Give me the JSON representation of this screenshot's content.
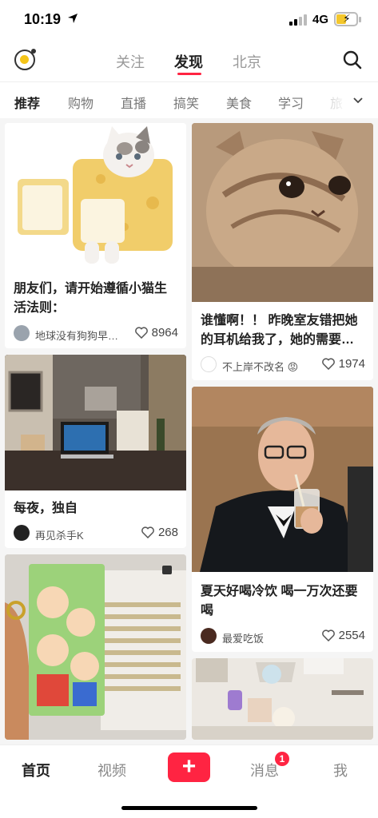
{
  "status_bar": {
    "time": "10:19",
    "network": "4G"
  },
  "top_nav": {
    "tabs": [
      {
        "label": "关注"
      },
      {
        "label": "发现"
      },
      {
        "label": "北京"
      }
    ],
    "active_tab": "发现"
  },
  "categories": [
    {
      "label": "推荐"
    },
    {
      "label": "购物"
    },
    {
      "label": "直播"
    },
    {
      "label": "搞笑"
    },
    {
      "label": "美食"
    },
    {
      "label": "学习"
    },
    {
      "label": "旅"
    }
  ],
  "feed": {
    "left": [
      {
        "title_line1": "朋友们，请开始遵循小猫生",
        "title_line2": "活法则：",
        "author": "地球没有狗狗早…",
        "likes": "8964"
      },
      {
        "title_line1": "每夜，独自",
        "author": "再见杀手K",
        "likes": "268"
      },
      {
        "title_line1": ""
      }
    ],
    "right": [
      {
        "title_line1": "谁懂啊！！ 昨晚室友错把她",
        "title_line2": "的耳机给我了，她的需要…",
        "author": "不上岸不改名 😡",
        "likes": "1974"
      },
      {
        "title_line1": "夏天好喝冷饮 喝一万次还要",
        "title_line2": "喝",
        "author": "最爱吃饭",
        "likes": "2554"
      },
      {
        "title_line1": ""
      }
    ]
  },
  "bottom_bar": {
    "home": "首页",
    "video": "视频",
    "add": "+",
    "messages": "消息",
    "messages_badge": "1",
    "me": "我"
  },
  "colors": {
    "accent": "#ff2442",
    "background": "#f5f5f5"
  }
}
